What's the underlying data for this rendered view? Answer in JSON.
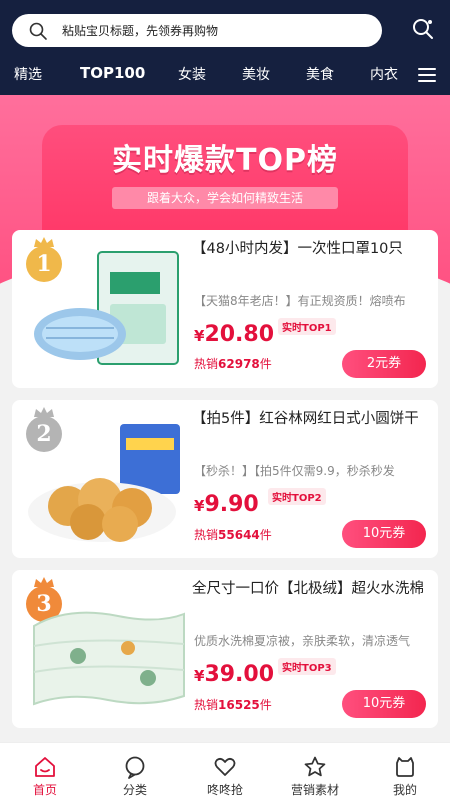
{
  "search": {
    "placeholder": "粘贴宝贝标题，先领券再购物"
  },
  "nav": {
    "items": [
      "精选",
      "TOP100",
      "女装",
      "美妆",
      "美食",
      "内衣"
    ],
    "active": "TOP100"
  },
  "hero": {
    "title": "实时爆款TOP榜",
    "subtitle": "跟着大众，学会如何精致生活"
  },
  "products": [
    {
      "rank": "1",
      "title": "【48小时内发】一次性口罩10只",
      "desc": "【天猫8年老店！】有正规资质！熔喷布",
      "currency": "¥",
      "price": "20.80",
      "rank_badge": "实时TOP1",
      "sold_prefix": "热销",
      "sold_count": "62978",
      "sold_unit": "件",
      "coupon": "2元券",
      "medal_color": "#f0b84a"
    },
    {
      "rank": "2",
      "title": "【拍5件】红谷林网红日式小圆饼干",
      "desc": "【秒杀！】【拍5件仅需9.9，秒杀秒发",
      "currency": "¥",
      "price": "9.90",
      "rank_badge": "实时TOP2",
      "sold_prefix": "热销",
      "sold_count": "55644",
      "sold_unit": "件",
      "coupon": "10元券",
      "medal_color": "#b4b4b4"
    },
    {
      "rank": "3",
      "title": "全尺寸一口价【北极绒】超火水洗棉",
      "desc": "优质水洗棉夏凉被，亲肤柔软，清凉透气",
      "currency": "¥",
      "price": "39.00",
      "rank_badge": "实时TOP3",
      "sold_prefix": "热销",
      "sold_count": "16525",
      "sold_unit": "件",
      "coupon": "10元券",
      "medal_color": "#f08a3a"
    }
  ],
  "tabbar": {
    "items": [
      {
        "label": "首页",
        "icon": "home-icon"
      },
      {
        "label": "分类",
        "icon": "chat-icon"
      },
      {
        "label": "咚咚抢",
        "icon": "heart-icon"
      },
      {
        "label": "营销素材",
        "icon": "star-icon"
      },
      {
        "label": "我的",
        "icon": "profile-icon"
      }
    ],
    "active": "首页"
  },
  "colors": {
    "header_bg": "#15203f",
    "accent": "#e3103c",
    "hero_pink": "#ff4f80"
  }
}
